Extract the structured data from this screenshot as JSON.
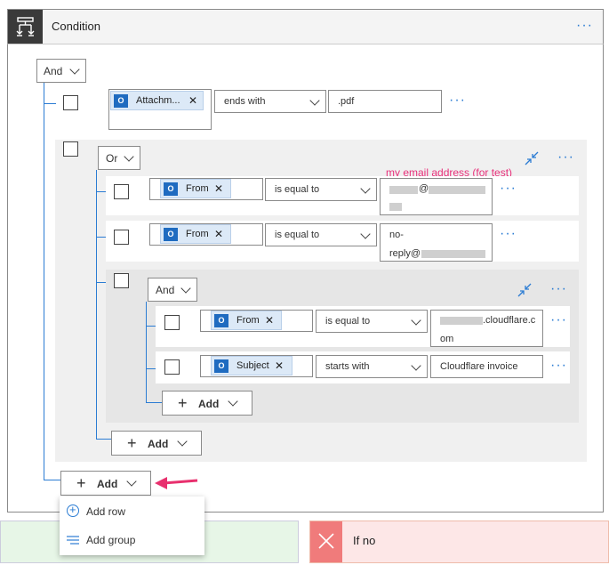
{
  "condition": {
    "title": "Condition",
    "more": "···",
    "root_operator": "And",
    "rows": [
      {
        "field": "Attachm...",
        "operator": "ends with",
        "value": ".pdf"
      }
    ],
    "or_group": {
      "operator": "Or",
      "annotation": "my email address (for test)",
      "rows": [
        {
          "field": "From",
          "operator": "is equal to",
          "value_line1": "@",
          "value_line2": ""
        },
        {
          "field": "From",
          "operator": "is equal to",
          "value_line1": "no-",
          "value_line2": "reply@"
        }
      ],
      "and_group": {
        "operator": "And",
        "rows": [
          {
            "field": "From",
            "operator": "is equal to",
            "value_line1": ".cloudflare.c",
            "value_line2": "om"
          },
          {
            "field": "Subject",
            "operator": "starts with",
            "value": "Cloudflare invoice"
          }
        ],
        "add_label": "Add"
      },
      "add_label": "Add"
    },
    "add_label": "Add",
    "menu": {
      "add_row": "Add row",
      "add_group": "Add group"
    }
  },
  "branches": {
    "if_no": "If no"
  },
  "colors": {
    "accent": "#2b7cd3",
    "annotation": "#e8307a",
    "arrow": "#e8306e"
  }
}
